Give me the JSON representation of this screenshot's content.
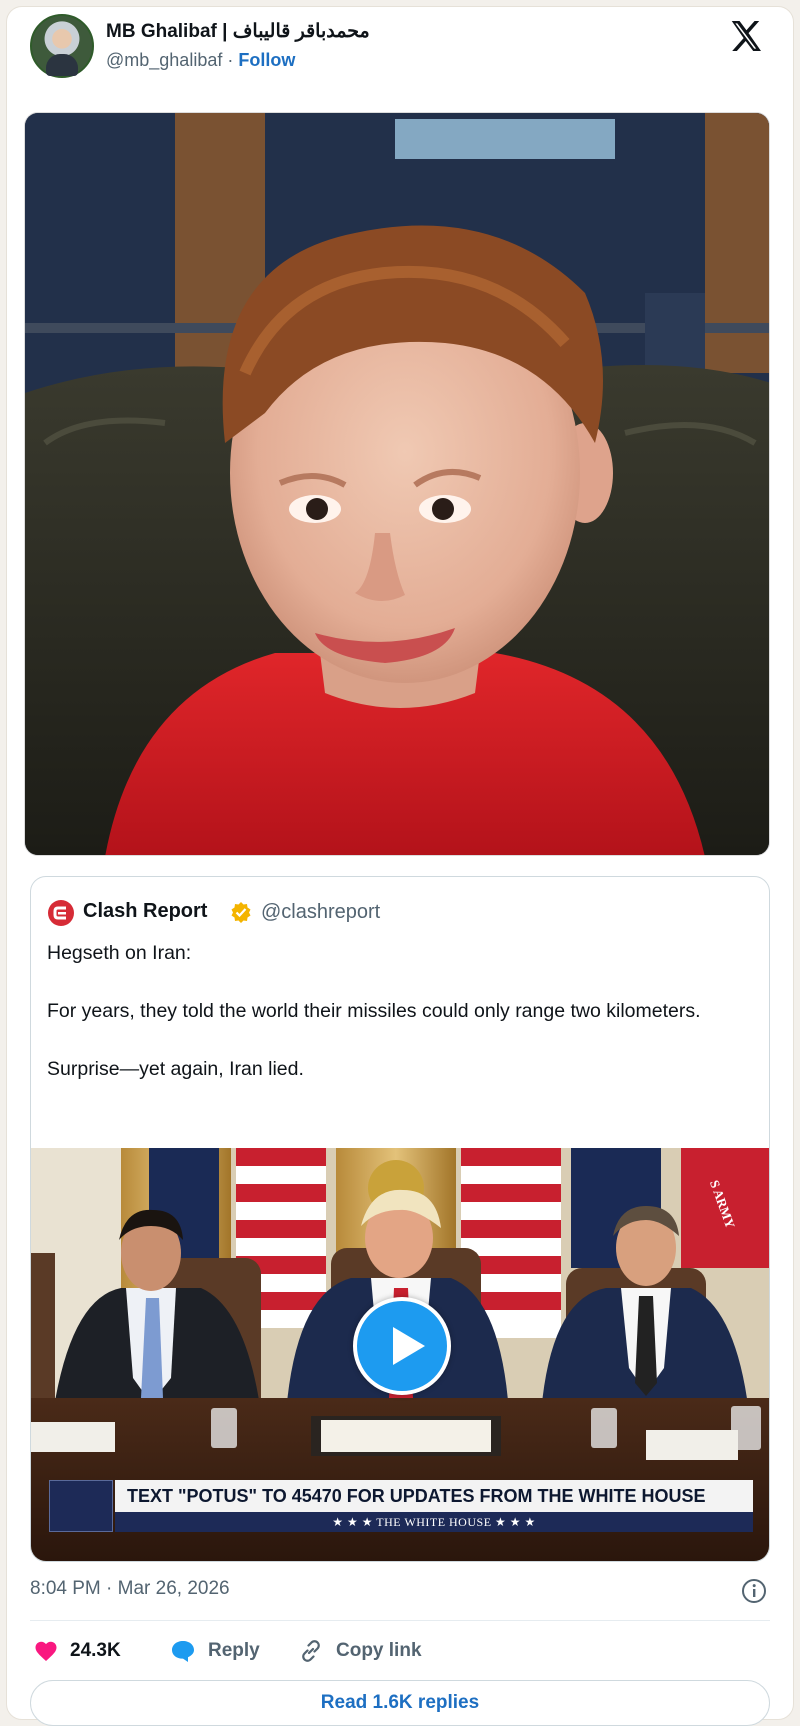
{
  "author": {
    "name": "MB Ghalibaf | محمدباقر قالیباف",
    "handle": "@mb_ghalibaf",
    "separator": "·",
    "follow_label": "Follow"
  },
  "quoted_post": {
    "name": "Clash Report",
    "handle": "@clashreport",
    "lines": [
      "Hegseth on Iran:",
      "For years, they told the world their missiles could only range two kilometers.",
      "Surprise—yet again, Iran lied."
    ],
    "video": {
      "chyron": "TEXT \"POTUS\" TO 45470 FOR UPDATES FROM THE WHITE HOUSE",
      "chyron_sub": "★ ★ ★   THE WHITE HOUSE   ★ ★ ★",
      "flag_text": "S ARMY"
    }
  },
  "meta": {
    "time": "8:04 PM",
    "separator": "·",
    "date": "Mar 26, 2026"
  },
  "actions": {
    "likes": "24.3K",
    "reply_label": "Reply",
    "copy_link_label": "Copy link"
  },
  "read_replies_label": "Read 1.6K replies",
  "colors": {
    "accent": "#1d9bf0",
    "link": "#1d6fc2",
    "heart": "#f91880",
    "verified": "#f4b400"
  }
}
